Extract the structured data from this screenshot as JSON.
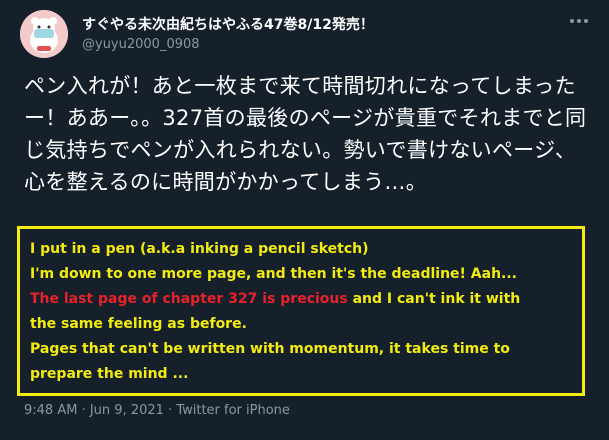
{
  "author": {
    "display_name": "すぐやる未次由紀ちはやふる47巻8/12発売！",
    "handle": "@yuyu2000_0908"
  },
  "tweet": {
    "text": "ペン入れが！あと一枚まで来て時間切れになってしまったー！ああー。。327首の最後のページが貴重でそれまでと同じ気持ちでペンが入れられない。勢いで書けないページ、心を整えるのに時間がかかってしまう…。"
  },
  "translation": {
    "line1": "I put in a pen (a.k.a inking  a pencil sketch)",
    "line2": "I'm down to one more page, and then it's the deadline! Aah...",
    "line3_red": "The last page of chapter 327 is precious",
    "line3_rest": " and I can't ink it with",
    "line4": "the same feeling as before.",
    "line5": "Pages that can't be written with momentum, it takes time to",
    "line6": "prepare the mind ...",
    "border_color": "#f2ec10",
    "text_color": "#f2ec10",
    "highlight_color": "#e8222a"
  },
  "meta": {
    "time": "9:48 AM",
    "separator1": " · ",
    "date": "Jun 9, 2021",
    "separator2": " · ",
    "source": "Twitter for iPhone"
  },
  "icons": {
    "more": "more-horizontal-icon",
    "avatar": "avatar-character"
  },
  "colors": {
    "background": "#15202b",
    "secondary_text": "#8899a6"
  }
}
